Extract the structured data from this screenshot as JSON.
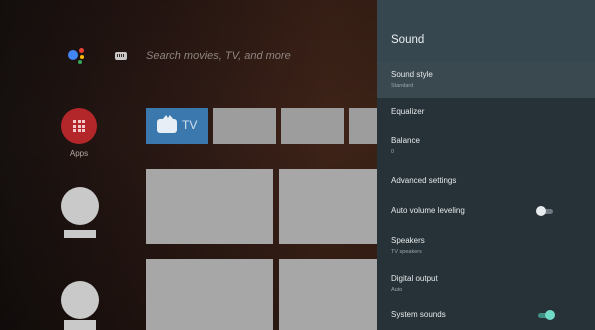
{
  "search": {
    "placeholder": "Search movies, TV, and more"
  },
  "apps": {
    "label": "Apps"
  },
  "tv_tile": {
    "label": "TV"
  },
  "settings_panel": {
    "title": "Sound",
    "items": [
      {
        "label": "Sound style",
        "value": "Standard",
        "focused": true
      },
      {
        "label": "Equalizer"
      },
      {
        "label": "Balance",
        "value": "0"
      },
      {
        "label": "Advanced settings"
      },
      {
        "label": "Auto volume leveling",
        "toggle": "off"
      },
      {
        "label": "Speakers",
        "value": "TV speakers"
      },
      {
        "label": "Digital output",
        "value": "Auto"
      },
      {
        "label": "System sounds",
        "toggle": "on"
      }
    ]
  },
  "colors": {
    "panel_background": "#263238",
    "panel_header": "#37474f",
    "toggle_on_accent": "#6fdac7",
    "apps_button": "#b3262a",
    "tv_tile": "#3b78ae"
  },
  "icons": {
    "assistant": "google-assistant-icon",
    "keyboard": "keyboard-icon",
    "apps": "apps-grid-icon",
    "tv": "tv-icon"
  }
}
